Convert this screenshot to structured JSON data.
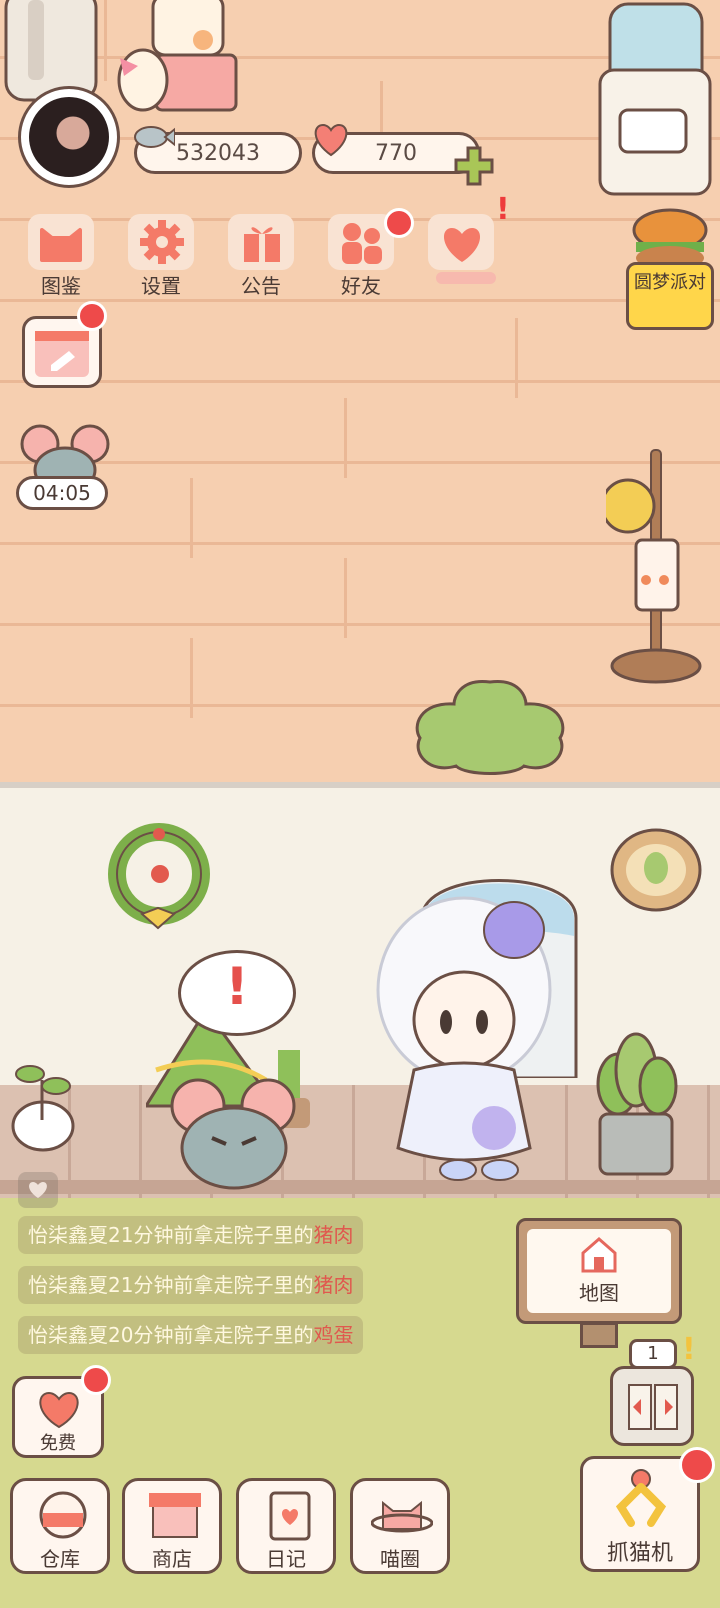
{
  "currency": {
    "fish": "532043",
    "hearts": "770"
  },
  "menu": [
    {
      "label": "图鉴",
      "icon": "cat-head-icon"
    },
    {
      "label": "设置",
      "icon": "gear-icon"
    },
    {
      "label": "公告",
      "icon": "gift-icon"
    },
    {
      "label": "好友",
      "icon": "friends-icon"
    },
    {
      "label": "",
      "icon": "heart-hands-icon"
    }
  ],
  "event": {
    "label": "圆梦派对"
  },
  "timer": {
    "value": "04:05"
  },
  "feed": [
    {
      "who": "怡柒鑫夏",
      "mid": "21分钟前拿走院子里的",
      "item": "猪肉"
    },
    {
      "who": "怡柒鑫夏",
      "mid": "21分钟前拿走院子里的",
      "item": "猪肉"
    },
    {
      "who": "怡柒鑫夏",
      "mid": "20分钟前拿走院子里的",
      "item": "鸡蛋"
    }
  ],
  "map": {
    "label": "地图"
  },
  "free": {
    "label": "免费"
  },
  "bottom_nav": [
    {
      "label": "仓库",
      "icon": "warehouse-icon"
    },
    {
      "label": "商店",
      "icon": "shop-icon"
    },
    {
      "label": "日记",
      "icon": "diary-icon"
    },
    {
      "label": "喵圈",
      "icon": "cat-planet-icon"
    }
  ],
  "claw": {
    "label": "抓猫机"
  },
  "elevator": {
    "floor": "1"
  },
  "alert": {
    "mark": "!"
  },
  "colors": {
    "badge": "#ee4a4a",
    "item_text": "#e0584e",
    "wall": "#f6cfb0",
    "grass": "#d6d98f"
  }
}
